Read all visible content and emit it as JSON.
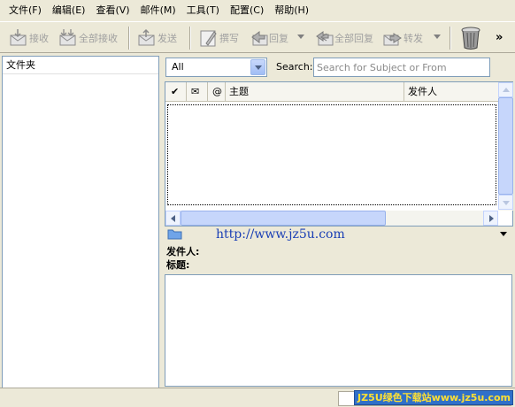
{
  "menu": [
    {
      "label": "文件(F)",
      "name": "menu-file"
    },
    {
      "label": "编辑(E)",
      "name": "menu-edit"
    },
    {
      "label": "查看(V)",
      "name": "menu-view"
    },
    {
      "label": "邮件(M)",
      "name": "menu-mail"
    },
    {
      "label": "工具(T)",
      "name": "menu-tools"
    },
    {
      "label": "配置(C)",
      "name": "menu-config"
    },
    {
      "label": "帮助(H)",
      "name": "menu-help"
    }
  ],
  "toolbar": {
    "receive": "接收",
    "receive_all": "全部接收",
    "send": "发送",
    "compose": "撰写",
    "reply": "回复",
    "reply_all": "全部回复",
    "forward": "转发",
    "more": "»"
  },
  "folders": {
    "header": "文件夹"
  },
  "filter": {
    "selected": "All",
    "search_label": "Search:",
    "search_placeholder": "Search for Subject or From"
  },
  "columns": {
    "flag": "✔",
    "status": "✉",
    "attach": "@",
    "subject": "主题",
    "sender": "发件人"
  },
  "watermark_url": "http://www.jz5u.com",
  "preview": {
    "from_label": "发件人:",
    "subject_label": "标题:"
  },
  "status": {
    "banner": "JZ5U绿色下载站www.jz5u.com"
  }
}
